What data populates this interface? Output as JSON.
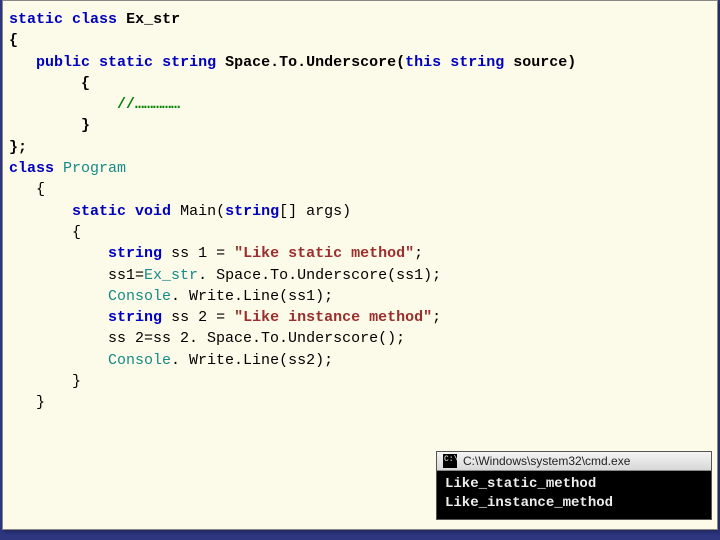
{
  "code": {
    "l1": {
      "kw1": "static",
      "kw2": "class",
      "name": "Ex_str"
    },
    "l2": "{",
    "l3": {
      "kw1": "public",
      "kw2": "static",
      "typ": "string",
      "name": "Space.To.Underscore",
      "kw3": "this",
      "typ2": "string",
      "arg": "source"
    },
    "l4": "{",
    "l5": "//……………",
    "l6": "}",
    "l7": "};",
    "l8": {
      "kw": "class",
      "name": "Program"
    },
    "l9": "{",
    "l10": {
      "kw1": "static",
      "typ": "void",
      "name": "Main",
      "typ2": "string",
      "arg": "args"
    },
    "l11": "{",
    "l12": {
      "typ": "string",
      "var": "ss 1",
      "str": "\"Like static method\""
    },
    "l13b": {
      "lhs": "ss1=",
      "cls": "Ex_str",
      "call": ". Space.To.Underscore(ss1);"
    },
    "l14": {
      "cls": "Console",
      "call": ". Write.Line(ss1);"
    },
    "l15": "",
    "l16": {
      "typ": "string",
      "var": "ss 2",
      "str": "\"Like instance method\""
    },
    "l17": "ss 2=ss 2. Space.To.Underscore();",
    "l18": {
      "cls": "Console",
      "call": ". Write.Line(ss2);"
    },
    "l19": "}",
    "l20": "",
    "l21": "}"
  },
  "console": {
    "title": "C:\\Windows\\system32\\cmd.exe",
    "line1": "Like_static_method",
    "line2": "Like_instance_method"
  }
}
